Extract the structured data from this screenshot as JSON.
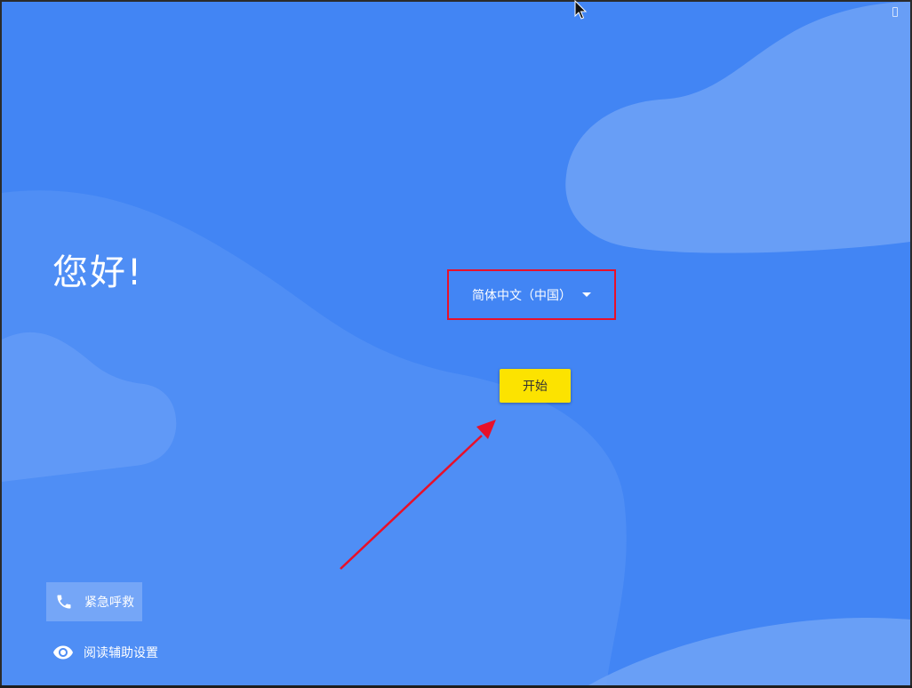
{
  "greeting": "您好!",
  "language_selector": {
    "value": "简体中文（中国）",
    "icon": "dropdown-caret-icon"
  },
  "start_button": {
    "label": "开始"
  },
  "bottom_actions": {
    "emergency": {
      "label": "紧急呼救",
      "icon": "phone-icon"
    },
    "accessibility": {
      "label": "阅读辅助设置",
      "icon": "eye-icon"
    }
  },
  "status_bar": {
    "icon": "battery-icon"
  },
  "annotations": {
    "highlight_color": "#e8102a",
    "arrow_color": "#e8102a"
  },
  "colors": {
    "background": "#4285f4",
    "accent_button": "#fce300"
  }
}
